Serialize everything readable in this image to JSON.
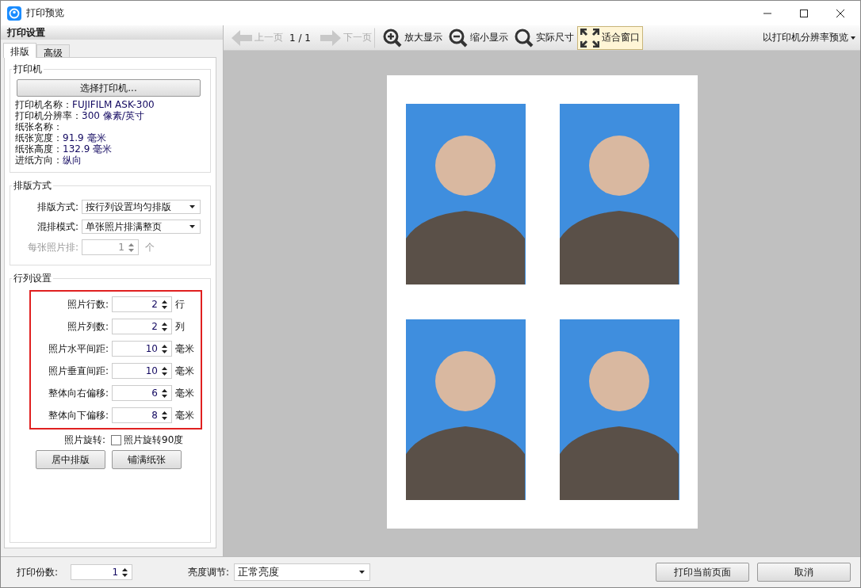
{
  "window": {
    "title": "打印预览"
  },
  "settings": {
    "title": "打印设置",
    "tabs": [
      {
        "label": "排版",
        "selected": true
      },
      {
        "label": "高级",
        "selected": false
      }
    ],
    "printer": {
      "legend": "打印机",
      "button": "选择打印机...",
      "info": [
        {
          "label": "打印机名称：",
          "value": "FUJIFILM ASK-300"
        },
        {
          "label": "打印机分辨率：",
          "value": "300 像素/英寸"
        },
        {
          "label": "纸张名称："
        },
        {
          "label": "纸张宽度：",
          "value": "91.9 毫米"
        },
        {
          "label": "纸张高度：",
          "value": "132.9 毫米"
        },
        {
          "label": "进纸方向：",
          "value": "纵向"
        }
      ]
    },
    "layout": {
      "legend": "排版方式",
      "dropdowns": [
        {
          "label": "排版方式:",
          "value": "按行列设置均匀排版"
        },
        {
          "label": "混排模式:",
          "value": "单张照片排满整页"
        }
      ],
      "per_sheet": {
        "label": "每张照片排:",
        "value": "1",
        "unit": "个",
        "disabled": true
      }
    },
    "grid": {
      "legend": "行列设置",
      "fields": [
        {
          "label": "照片行数:",
          "value": "2",
          "unit": "行"
        },
        {
          "label": "照片列数:",
          "value": "2",
          "unit": "列"
        },
        {
          "label": "照片水平间距:",
          "value": "10",
          "unit": "毫米"
        },
        {
          "label": "照片垂直间距:",
          "value": "10",
          "unit": "毫米"
        },
        {
          "label": "整体向右偏移:",
          "value": "6",
          "unit": "毫米"
        },
        {
          "label": "整体向下偏移:",
          "value": "8",
          "unit": "毫米"
        }
      ],
      "rotation": {
        "label": "照片旋转:",
        "checkbox": "照片旋转90度",
        "checked": false
      },
      "buttons": [
        "居中排版",
        "铺满纸张"
      ]
    }
  },
  "toolbar": {
    "items": [
      {
        "kind": "prev",
        "label": "上一页",
        "disabled": true
      },
      {
        "kind": "page",
        "label": "1 / 1"
      },
      {
        "kind": "next",
        "label": "下一页",
        "disabled": true
      },
      {
        "kind": "zoom-in",
        "label": "放大显示",
        "selected": false
      },
      {
        "kind": "zoom-out",
        "label": "缩小显示",
        "selected": false
      },
      {
        "kind": "actual",
        "label": "实际尺寸",
        "selected": false
      },
      {
        "kind": "fit",
        "label": "适合窗口",
        "selected": true
      }
    ],
    "preview_mode": "以打印机分辨率预览"
  },
  "bottom": {
    "copies": {
      "label": "打印份数:",
      "value": "1"
    },
    "brightness": {
      "label": "亮度调节:",
      "value": "正常亮度"
    },
    "buttons": [
      "打印当前页面",
      "取消"
    ]
  }
}
